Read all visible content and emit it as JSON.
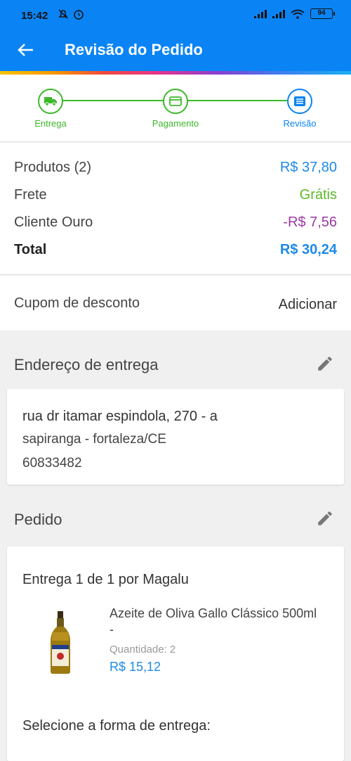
{
  "status_bar": {
    "time": "15:42",
    "battery": "94"
  },
  "header": {
    "title": "Revisão do Pedido"
  },
  "stepper": {
    "steps": [
      {
        "label": "Entrega"
      },
      {
        "label": "Pagamento"
      },
      {
        "label": "Revisão"
      }
    ]
  },
  "summary": {
    "products": {
      "label": "Produtos (2)",
      "value": "R$ 37,80"
    },
    "shipping": {
      "label": "Frete",
      "value": "Grátis"
    },
    "gold": {
      "label": "Cliente Ouro",
      "value": "-R$ 7,56"
    },
    "total": {
      "label": "Total",
      "value": "R$ 30,24"
    }
  },
  "coupon": {
    "label": "Cupom de desconto",
    "action": "Adicionar"
  },
  "address": {
    "title": "Endereço de entrega",
    "line1": "rua dr itamar espindola, 270 - a",
    "line2": "sapiranga - fortaleza/CE",
    "line3": "60833482"
  },
  "order": {
    "title": "Pedido",
    "delivery_title": "Entrega 1 de 1 por Magalu",
    "product": {
      "name": "Azeite de Oliva Gallo Clássico 500ml -",
      "quantity": "Quantidade:  2",
      "price": "R$ 15,12"
    },
    "shipping_prompt": "Selecione a forma de entrega:"
  },
  "colors": {
    "header_blue": "#0a84f5",
    "green": "#3bb82a",
    "price_blue": "#1d8ae8",
    "purple": "#9a3aa5"
  }
}
